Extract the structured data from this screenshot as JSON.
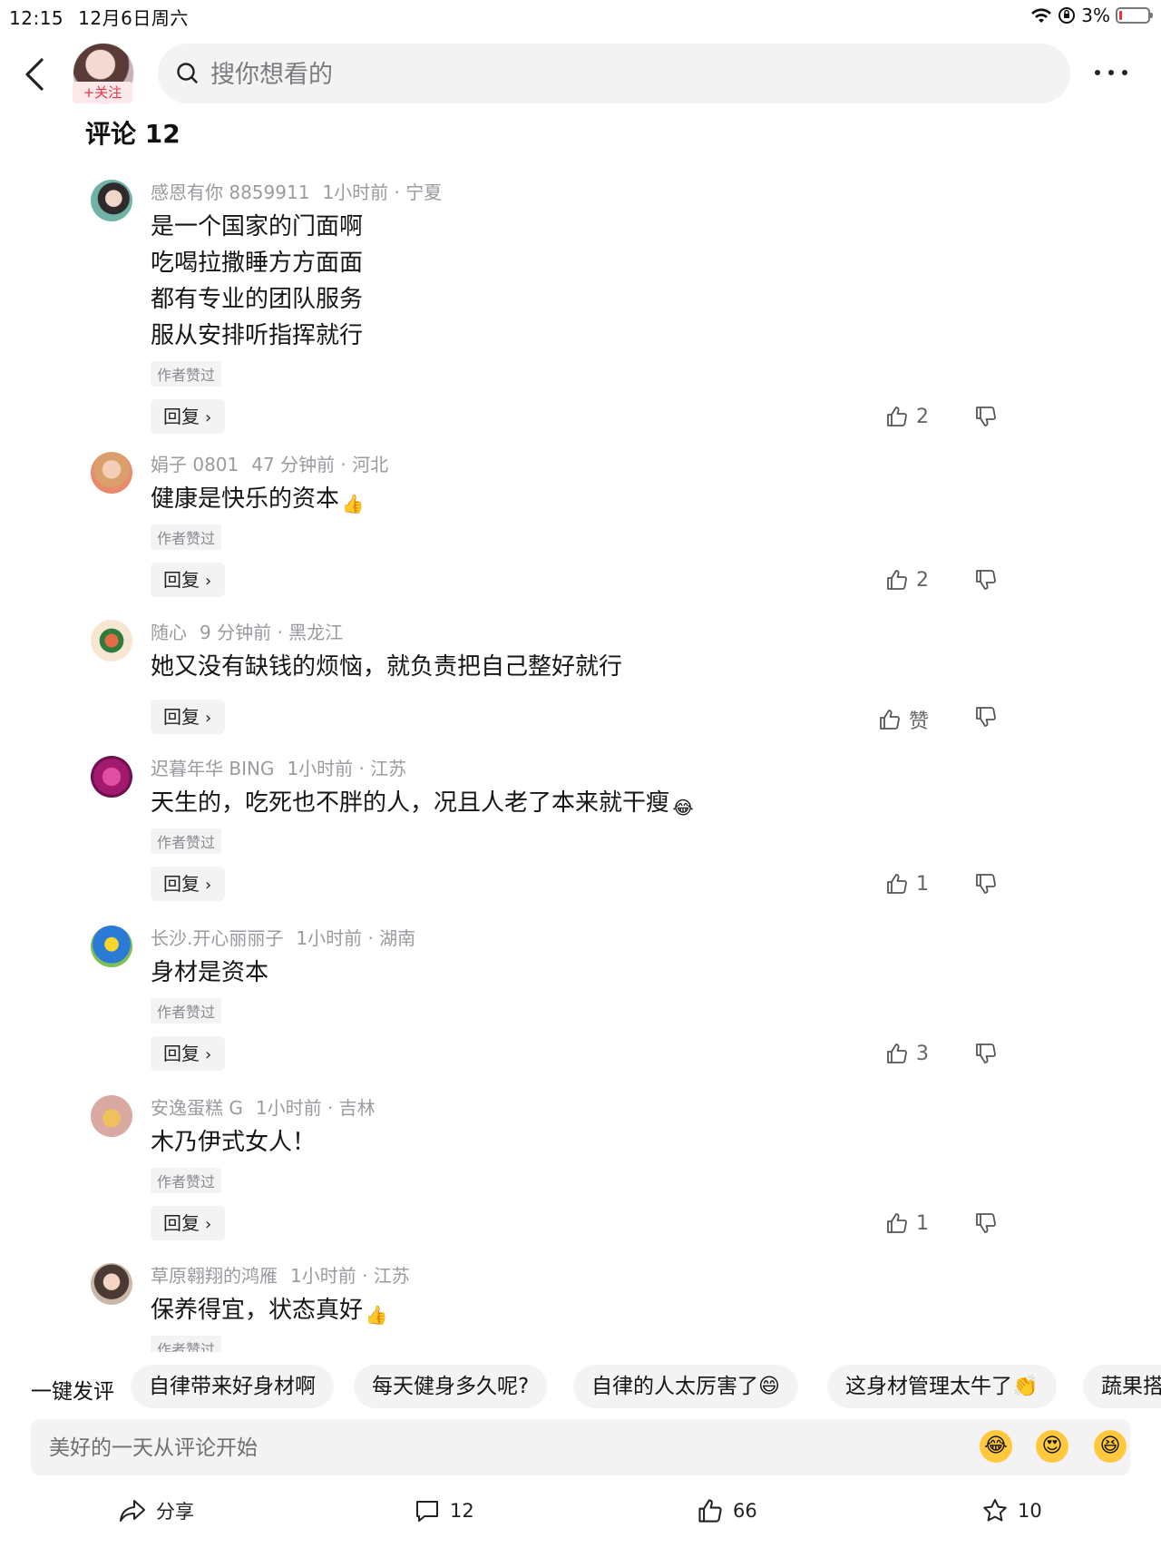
{
  "status_bar": {
    "time": "12:15",
    "date": "12月6日周六",
    "battery": "3%"
  },
  "top": {
    "follow_label": "+关注",
    "search_placeholder": "搜你想看的"
  },
  "comments_title": "评论 12",
  "comments": [
    {
      "user": "感恩有你 8859911",
      "time": "1小时前",
      "location": "宁夏",
      "lines": [
        "是一个国家的门面啊",
        "吃喝拉撒睡方方面面",
        "都有专业的团队服务",
        "服从安排听指挥就行"
      ],
      "tag": "作者赞过",
      "reply": "回复",
      "likes": "2"
    },
    {
      "user": "娟子 0801",
      "time": "47 分钟前",
      "location": "河北",
      "lines": [
        "健康是快乐的资本"
      ],
      "tag": "作者赞过",
      "reply": "回复",
      "likes": "2",
      "emoji": "👍"
    },
    {
      "user": "随心",
      "time": "9 分钟前",
      "location": "黑龙江",
      "lines": [
        "她又没有缺钱的烦恼，就负责把自己整好就行"
      ],
      "reply": "回复",
      "likes": "赞"
    },
    {
      "user": "迟暮年华 BING",
      "time": "1小时前",
      "location": "江苏",
      "lines": [
        "天生的，吃死也不胖的人，况且人老了本来就干瘦"
      ],
      "tag": "作者赞过",
      "reply": "回复",
      "likes": "1",
      "emoji": "😂"
    },
    {
      "user": "长沙.开心丽丽子",
      "time": "1小时前",
      "location": "湖南",
      "lines": [
        "身材是资本"
      ],
      "tag": "作者赞过",
      "reply": "回复",
      "likes": "3"
    },
    {
      "user": "安逸蛋糕 G",
      "time": "1小时前",
      "location": "吉林",
      "lines": [
        "木乃伊式女人！"
      ],
      "tag": "作者赞过",
      "reply": "回复",
      "likes": "1"
    },
    {
      "user": "草原翱翔的鸿雁",
      "time": "1小时前",
      "location": "江苏",
      "lines": [
        "保养得宜，状态真好"
      ],
      "tag": "作者赞过",
      "emoji": "👍"
    }
  ],
  "quick_reply": {
    "label": "一键发评",
    "chips": [
      "自律带来好身材啊",
      "每天健身多久呢?",
      "自律的人太厉害了😄",
      "这身材管理太牛了👏",
      "蔬果搭"
    ]
  },
  "comment_input_placeholder": "美好的一天从评论开始",
  "bottom": {
    "share": "分享",
    "comments": "12",
    "likes": "66",
    "favorites": "10"
  }
}
